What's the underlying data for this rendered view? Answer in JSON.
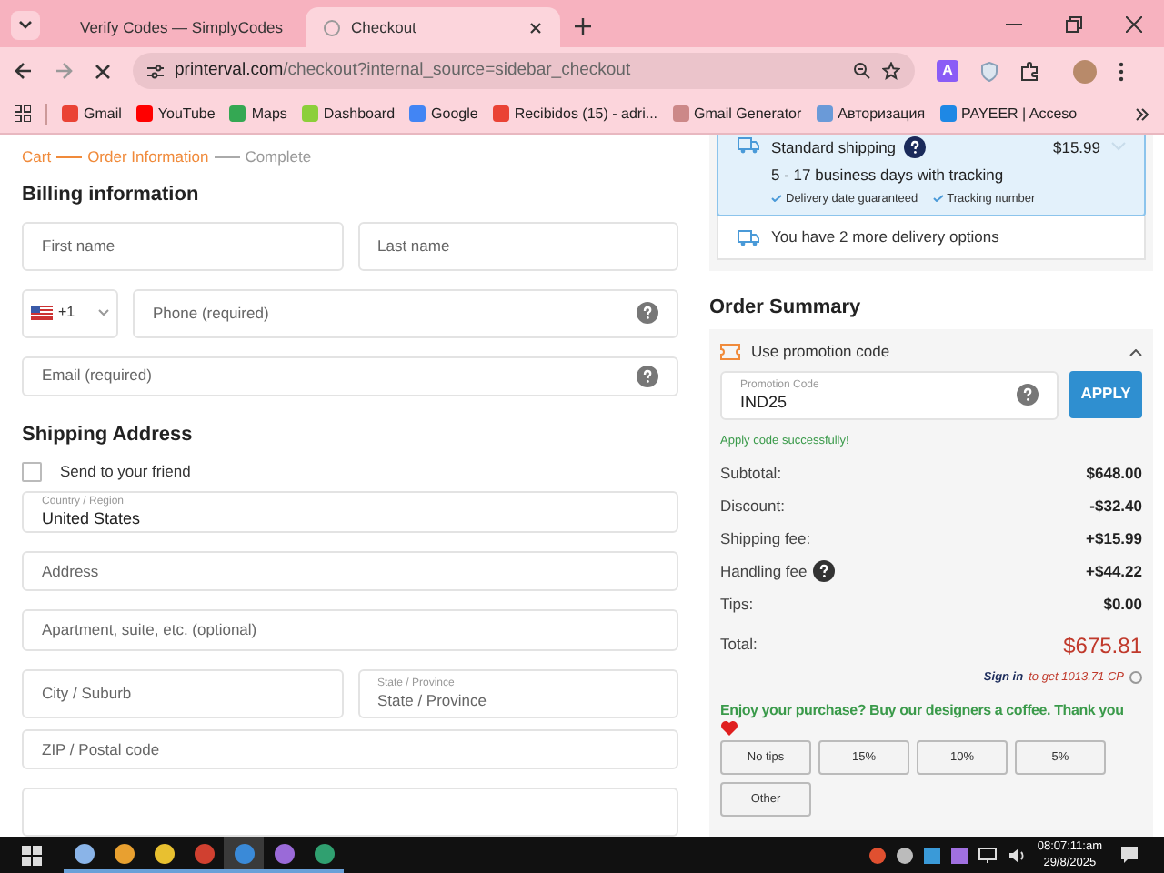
{
  "browser": {
    "tabs": [
      {
        "title": "Verify Codes — SimplyCodes",
        "selected": false
      },
      {
        "title": "Checkout",
        "selected": true
      }
    ],
    "url_host": "printerval.com",
    "url_path": "/checkout?internal_source=sidebar_checkout",
    "extension_letter": "A",
    "bookmarks": [
      "Gmail",
      "YouTube",
      "Maps",
      "Dashboard",
      "Google",
      "Recibidos (15) - adri...",
      "Gmail Generator",
      "Авторизация",
      "PAYEER | Acceso"
    ]
  },
  "steps": [
    {
      "label": "Cart",
      "active": true
    },
    {
      "label": "Order Information",
      "active": true
    },
    {
      "label": "Complete",
      "active": false
    }
  ],
  "billing": {
    "title": "Billing information",
    "first_name": {
      "placeholder": "First name"
    },
    "last_name": {
      "placeholder": "Last name"
    },
    "phone_code": "+1",
    "phone": {
      "placeholder": "Phone (required)"
    },
    "email": {
      "placeholder": "Email (required)"
    }
  },
  "shipping": {
    "title": "Shipping Address",
    "send_to_friend": {
      "label": "Send to your friend",
      "checked": false
    },
    "country": {
      "label": "Country / Region",
      "value": "United States"
    },
    "address": {
      "placeholder": "Address"
    },
    "apartment": {
      "placeholder": "Apartment, suite, etc. (optional)"
    },
    "city": {
      "placeholder": "City / Suburb"
    },
    "state": {
      "label": "State / Province",
      "placeholder": "State / Province"
    },
    "zip": {
      "placeholder": "ZIP / Postal code"
    }
  },
  "delivery": {
    "method": "Standard shipping",
    "price": "$15.99",
    "duration": "5 - 17 business days with tracking",
    "features": [
      "Delivery date guaranteed",
      "Tracking number"
    ],
    "more_options": "You have 2 more delivery options"
  },
  "summary": {
    "title": "Order Summary",
    "promo_toggle": "Use promotion code",
    "expanded": true,
    "promo": {
      "label": "Promotion Code",
      "value": "IND25"
    },
    "apply": "APPLY",
    "success": "Apply code successfully!",
    "lines": [
      {
        "label": "Subtotal:",
        "value": "$648.00",
        "info": false
      },
      {
        "label": "Discount:",
        "value": "-$32.40",
        "info": false
      },
      {
        "label": "Shipping fee:",
        "value": "+$15.99",
        "info": false
      },
      {
        "label": "Handling fee",
        "value": "+$44.22",
        "info": true
      },
      {
        "label": "Tips:",
        "value": "$0.00",
        "info": false
      }
    ],
    "total_label": "Total:",
    "total": "$675.81",
    "sign_in": "Sign in",
    "points": "to get 1013.71 CP",
    "tip_prompt": "Enjoy your purchase? Buy our designers a coffee. Thank you",
    "tips": [
      "No tips",
      "15%",
      "10%",
      "5%",
      "Other"
    ]
  },
  "taskbar": {
    "time": "08:07:11:am",
    "date": "29/8/2025"
  }
}
